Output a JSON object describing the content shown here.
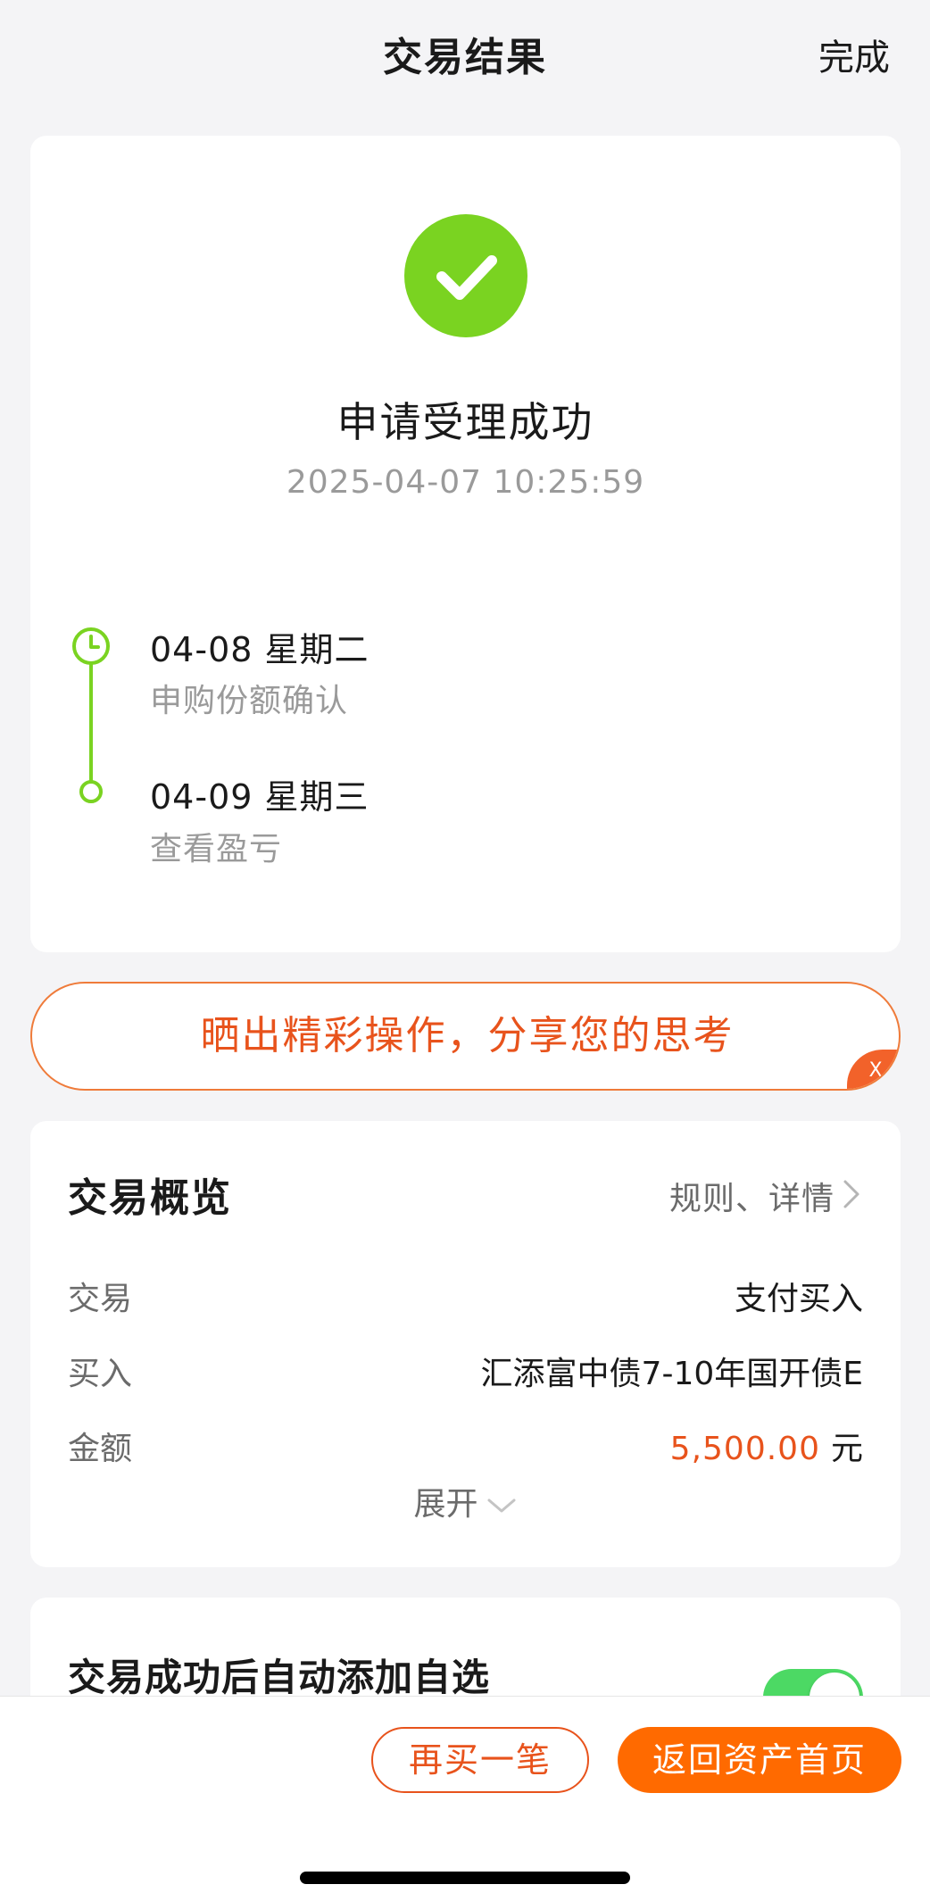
{
  "header": {
    "title": "交易结果",
    "done_label": "完成"
  },
  "result": {
    "icon": "check-icon",
    "status_color": "#7ad321",
    "title": "申请受理成功",
    "time": "2025-04-07 10:25:59"
  },
  "timeline": [
    {
      "date": "04-08  星期二",
      "desc": "申购份额确认",
      "icon": "clock-icon"
    },
    {
      "date": "04-09  星期三",
      "desc": "查看盈亏",
      "icon": "dot-icon"
    }
  ],
  "share_banner": {
    "text": "晒出精彩操作，分享您的思考",
    "close_label": "X"
  },
  "overview": {
    "title": "交易概览",
    "link_label": "规则、详情",
    "rows": [
      {
        "label": "交易",
        "value": "支付买入"
      },
      {
        "label": "买入",
        "value": "汇添富中债7-10年国开债E"
      },
      {
        "label": "金额",
        "amount": "5,500.00",
        "unit": "元"
      }
    ],
    "expand_label": "展开"
  },
  "auto_add": {
    "title": "交易成功后自动添加自选",
    "toggle_on": true
  },
  "bottom_bar": {
    "rebuy_label": "再买一笔",
    "home_label": "返回资产首页",
    "accent_color": "#ff6a00"
  }
}
